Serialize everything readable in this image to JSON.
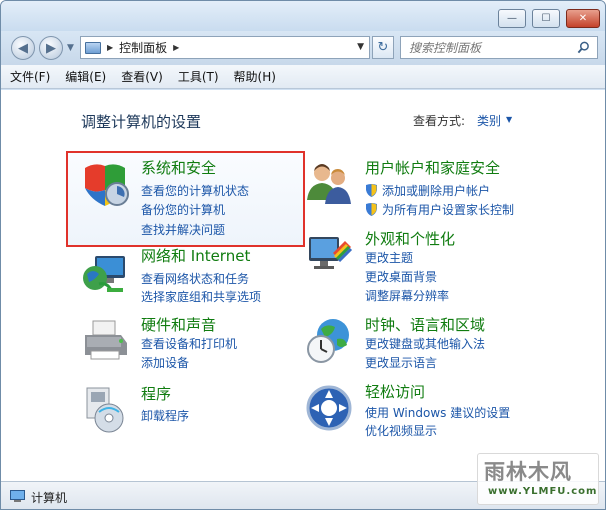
{
  "window": {
    "min": "—",
    "max": "☐",
    "close": "✕"
  },
  "address": {
    "path": "控制面板",
    "search_placeholder": "搜索控制面板"
  },
  "menu": [
    "文件(F)",
    "编辑(E)",
    "查看(V)",
    "工具(T)",
    "帮助(H)"
  ],
  "content": {
    "title": "调整计算机的设置",
    "view_by_label": "查看方式:",
    "view_by_value": "类别"
  },
  "categories": {
    "system": {
      "title": "系统和安全",
      "links": [
        "查看您的计算机状态",
        "备份您的计算机",
        "查找并解决问题"
      ]
    },
    "users": {
      "title": "用户帐户和家庭安全",
      "links": [
        "添加或删除用户帐户",
        "为所有用户设置家长控制"
      ]
    },
    "network": {
      "title": "网络和 Internet",
      "links": [
        "查看网络状态和任务",
        "选择家庭组和共享选项"
      ]
    },
    "appearance": {
      "title": "外观和个性化",
      "links": [
        "更改主题",
        "更改桌面背景",
        "调整屏幕分辨率"
      ]
    },
    "hardware": {
      "title": "硬件和声音",
      "links": [
        "查看设备和打印机",
        "添加设备"
      ]
    },
    "clock": {
      "title": "时钟、语言和区域",
      "links": [
        "更改键盘或其他输入法",
        "更改显示语言"
      ]
    },
    "programs": {
      "title": "程序",
      "links": [
        "卸载程序"
      ]
    },
    "access": {
      "title": "轻松访问",
      "links": [
        "使用 Windows 建议的设置",
        "优化视频显示"
      ]
    }
  },
  "status": {
    "text": "计算机"
  },
  "watermark": {
    "logo": "雨林木风",
    "url": "www.YLMFU.com"
  }
}
